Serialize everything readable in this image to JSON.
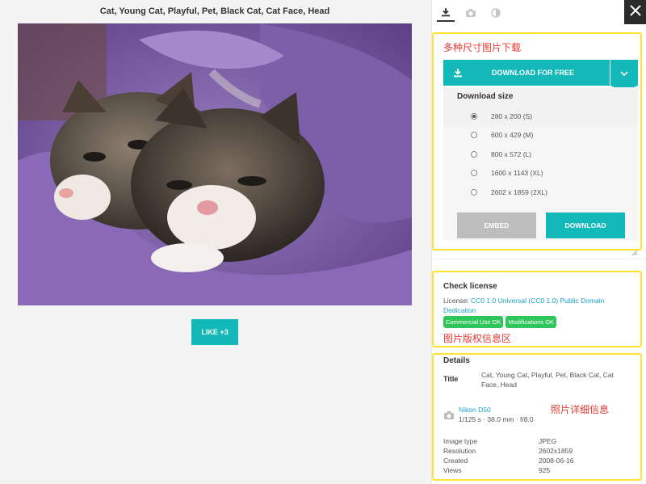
{
  "left": {
    "image_title": "Cat, Young Cat, Playful, Pet, Black Cat, Cat Face, Head",
    "like_label": "LIKE +3"
  },
  "tabs": [
    {
      "icon": "download-icon",
      "active": true
    },
    {
      "icon": "camera-icon",
      "active": false
    },
    {
      "icon": "contrast-icon",
      "active": false
    }
  ],
  "annotations": {
    "sizes": "多种尺寸图片下载",
    "license": "图片版权信息区",
    "details": "照片详细信息"
  },
  "download": {
    "main_label": "DOWNLOAD FOR FREE",
    "size_heading": "Download size",
    "options": [
      {
        "label": "280 x 200 (S)",
        "selected": true
      },
      {
        "label": "600 x 429 (M)",
        "selected": false
      },
      {
        "label": "800 x 572 (L)",
        "selected": false
      },
      {
        "label": "1600 x 1143 (XL)",
        "selected": false
      },
      {
        "label": "2602 x 1859 (2XL)",
        "selected": false
      }
    ],
    "embed_label": "EMBED",
    "download_label": "DOWNLOAD"
  },
  "license": {
    "heading": "Check license",
    "prefix": "License: ",
    "link": "CC0 1.0 Universal (CC0 1.0) Public Domain Dedication",
    "badges": [
      "Commercial Use OK",
      "Modifications OK"
    ]
  },
  "details": {
    "heading": "Details",
    "title_key": "Title",
    "title_value": "Cat, Young Cat, Playful, Pet, Black Cat, Cat Face, Head",
    "camera": "Nikon D50",
    "camera_info": "1/125 s · 38.0 mm · f/8.0",
    "meta": [
      {
        "key": "Image type",
        "value": "JPEG"
      },
      {
        "key": "Resolution",
        "value": "2602x1859"
      },
      {
        "key": "Created",
        "value": "2008-06-16"
      },
      {
        "key": "Views",
        "value": "925"
      }
    ]
  },
  "colors": {
    "accent": "#13b8b8",
    "highlight": "#ffe12e",
    "annotation": "#e53935",
    "badge": "#2ec65a",
    "link": "#1aa0c8"
  }
}
